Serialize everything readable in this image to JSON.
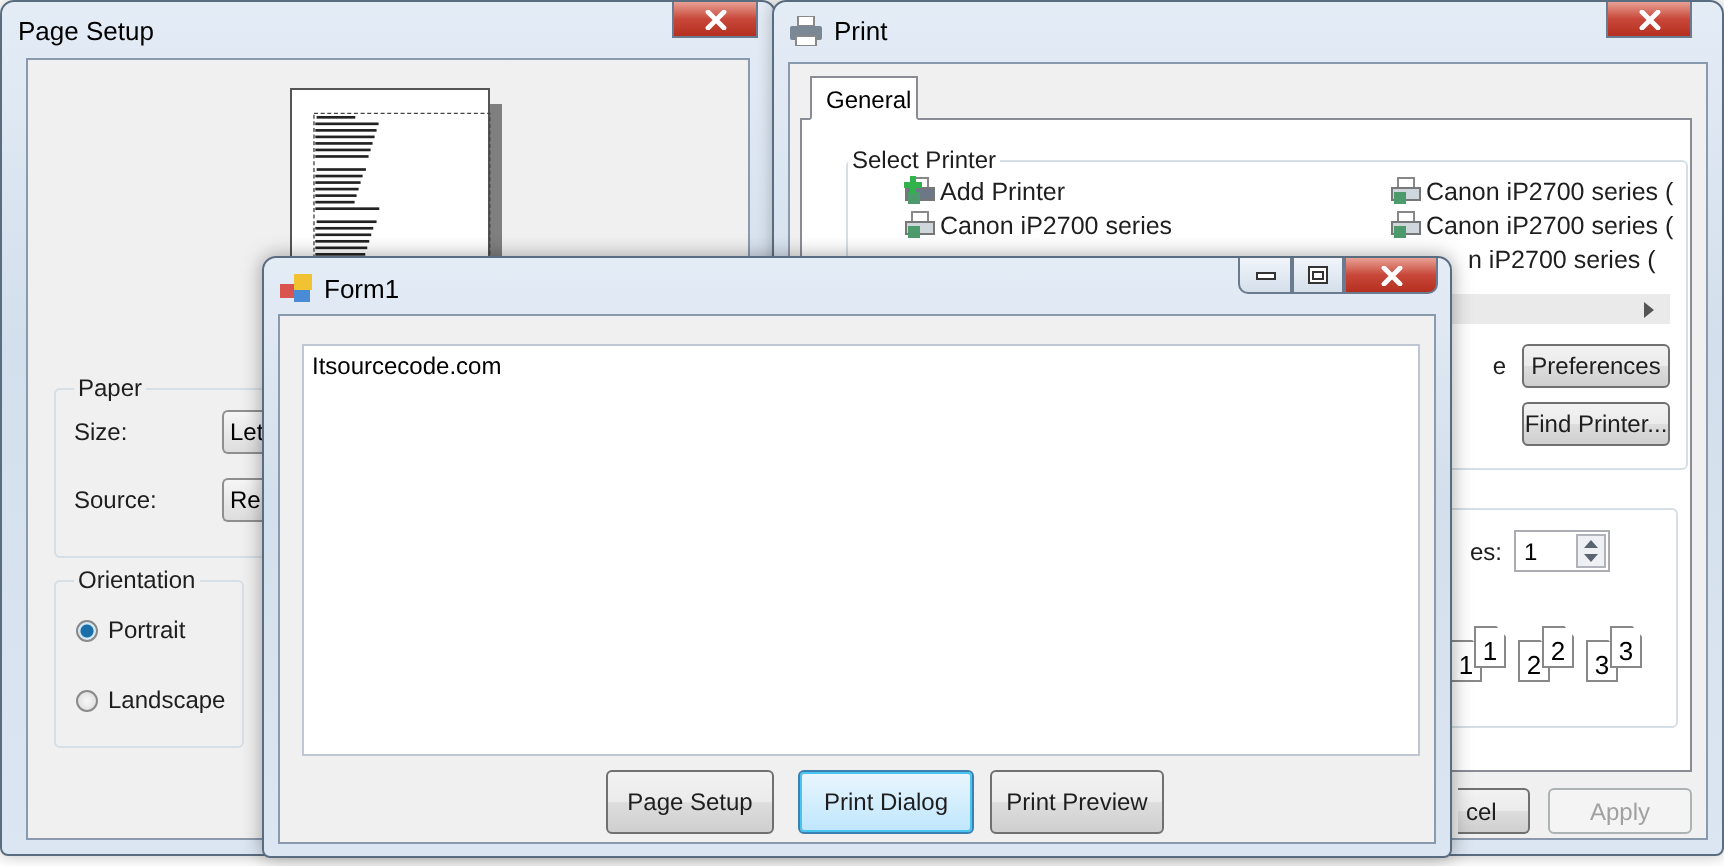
{
  "page_setup": {
    "title": "Page Setup",
    "paper": {
      "label": "Paper",
      "size_label": "Size:",
      "size_value": "Let",
      "source_label": "Source:",
      "source_value": "Re"
    },
    "orientation": {
      "label": "Orientation",
      "options": [
        {
          "label": "Portrait",
          "selected": true
        },
        {
          "label": "Landscape",
          "selected": false
        }
      ]
    }
  },
  "print": {
    "title": "Print",
    "tabs": [
      {
        "label": "General",
        "selected": true
      }
    ],
    "select_printer": {
      "label": "Select Printer",
      "left": [
        {
          "name": "Add Printer",
          "kind": "add"
        },
        {
          "name": "Canon iP2700 series",
          "kind": "printer"
        }
      ],
      "right": [
        {
          "name": "Canon iP2700 series (",
          "kind": "printer"
        },
        {
          "name": "Canon iP2700 series (",
          "kind": "printer"
        },
        {
          "name": "n iP2700 series (",
          "kind": "cut"
        }
      ],
      "file_label": "e",
      "buttons": [
        "Preferences",
        "Find Printer..."
      ]
    },
    "copies_label": "es:",
    "copies_value": "1",
    "collate": [
      {
        "back": "1",
        "front": "1"
      },
      {
        "back": "2",
        "front": "2"
      },
      {
        "back": "3",
        "front": "3"
      }
    ],
    "footer_buttons": [
      {
        "label": "cel",
        "disabled": false
      },
      {
        "label": "Apply",
        "disabled": true
      }
    ]
  },
  "form1": {
    "title": "Form1",
    "text": "Itsourcecode.com",
    "buttons": [
      {
        "label": "Page Setup",
        "focused": false
      },
      {
        "label": "Print Dialog",
        "focused": true
      },
      {
        "label": "Print Preview",
        "focused": false
      }
    ]
  }
}
